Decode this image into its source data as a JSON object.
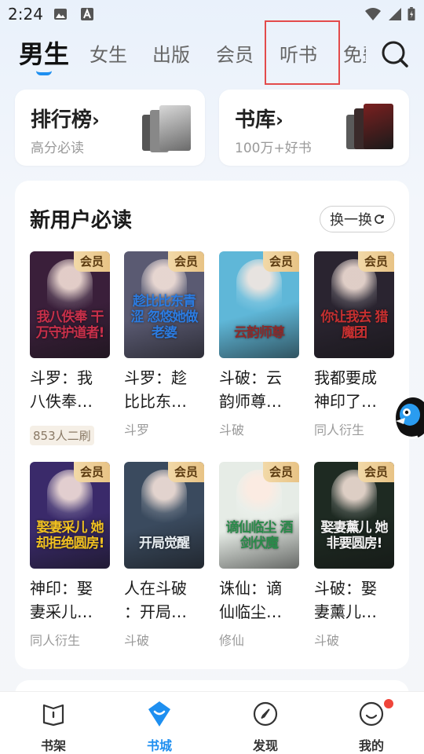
{
  "status": {
    "time": "2:24"
  },
  "tabs": [
    {
      "label": "男生",
      "active": true
    },
    {
      "label": "女生"
    },
    {
      "label": "出版"
    },
    {
      "label": "会员"
    },
    {
      "label": "听书"
    },
    {
      "label": "免费"
    }
  ],
  "quick": {
    "rank": {
      "title": "排行榜",
      "arrow": "›",
      "sub": "高分必读"
    },
    "library": {
      "title": "书库",
      "arrow": "›",
      "sub": "100万+好书"
    }
  },
  "section": {
    "title": "新用户必读",
    "refresh_label": "换一换"
  },
  "books": [
    {
      "title_line1": "斗罗：我",
      "title_line2": "八佚奉…",
      "tag": "853人二刷",
      "tag_badge": true,
      "vip": "会员",
      "cover_text": "我八佚奉 干万守护道者!",
      "cover_color": "#3a1f3a",
      "cover_accent": "#c8304a"
    },
    {
      "title_line1": "斗罗：趁",
      "title_line2": "比比东…",
      "tag": "斗罗",
      "vip": "会员",
      "cover_text": "趁比比东青涩 忽悠她做老婆",
      "cover_color": "#5a5a72",
      "cover_accent": "#2b7be0"
    },
    {
      "title_line1": "斗破：云",
      "title_line2": "韵师尊…",
      "tag": "斗破",
      "vip": "会员",
      "cover_text": "云韵师尊",
      "cover_color": "#5fb7d8",
      "cover_accent": "#8a2a2a"
    },
    {
      "title_line1": "我都要成",
      "title_line2": "神印了…",
      "tag": "同人衍生",
      "vip": "会员",
      "cover_text": "你让我去 猎魔团",
      "cover_color": "#2a2430",
      "cover_accent": "#c83030"
    },
    {
      "title_line1": "神印：娶",
      "title_line2": "妻采儿…",
      "tag": "同人衍生",
      "vip": "会员",
      "cover_text": "娶妻采儿 她却拒绝圆房!",
      "cover_color": "#3a2a6a",
      "cover_accent": "#f0c020"
    },
    {
      "title_line1": "人在斗破",
      "title_line2": "：开局…",
      "tag": "斗破",
      "vip": "会员",
      "cover_text": "开局觉醒",
      "cover_color": "#3a4a5e",
      "cover_accent": "#e8eef2"
    },
    {
      "title_line1": "诛仙：谪",
      "title_line2": "仙临尘…",
      "tag": "修仙",
      "vip": "会员",
      "cover_text": "谪仙临尘 酒剑伏魔",
      "cover_color": "#e6ece6",
      "cover_accent": "#2a8a4a"
    },
    {
      "title_line1": "斗破：娶",
      "title_line2": "妻薰儿…",
      "tag": "斗破",
      "vip": "会员",
      "cover_text": "娶妻薰儿 她非要圆房!",
      "cover_color": "#1e2a22",
      "cover_accent": "#f2f2f2"
    }
  ],
  "nav": [
    {
      "label": "书架",
      "icon": "bookshelf-icon"
    },
    {
      "label": "书城",
      "icon": "bookstore-icon",
      "active": true
    },
    {
      "label": "发现",
      "icon": "discover-icon"
    },
    {
      "label": "我的",
      "icon": "profile-icon",
      "dot": true
    }
  ],
  "colors": {
    "accent": "#1e8ff0",
    "vip_gold": "#e8c385",
    "highlight": "#e34b4b"
  }
}
